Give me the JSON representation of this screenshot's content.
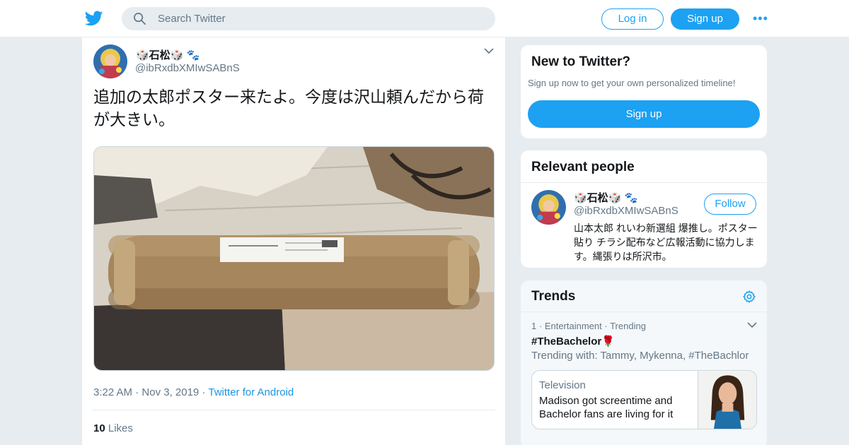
{
  "header": {
    "search_placeholder": "Search Twitter",
    "login_label": "Log in",
    "signup_label": "Sign up",
    "more_label": "•••"
  },
  "tweet": {
    "display_name": "🎲石松🎲 🐾",
    "handle": "@ibRxdbXMIwSABnS",
    "text": "追加の太郎ポスター来たよ。今度は沢山頼んだから荷が大きい。",
    "time": "3:22 AM",
    "date": "Nov 3, 2019",
    "source": "Twitter for Android",
    "likes_count": "10",
    "likes_label": "Likes"
  },
  "new_to_twitter": {
    "title": "New to Twitter?",
    "subtitle": "Sign up now to get your own personalized timeline!",
    "button_label": "Sign up"
  },
  "relevant_people": {
    "title": "Relevant people",
    "person": {
      "display_name": "🎲石松🎲 🐾",
      "handle": "@ibRxdbXMIwSABnS",
      "follow_label": "Follow",
      "bio": "山本太郎 れいわ新選組 爆推し。ポスター貼り チラシ配布など広報活動に協力します。縄張りは所沢市。"
    }
  },
  "trends": {
    "title": "Trends",
    "item": {
      "rank": "1",
      "category": "Entertainment",
      "status": "Trending",
      "hashtag": "#TheBachelor🌹",
      "trending_with": "Trending with: Tammy, Mykenna, #TheBachlor",
      "news_category": "Television",
      "news_headline": "Madison got screentime and Bachelor fans are living for it"
    }
  },
  "colors": {
    "accent": "#1da1f2",
    "secondary_text": "#657786",
    "background": "#e6ecf0"
  }
}
